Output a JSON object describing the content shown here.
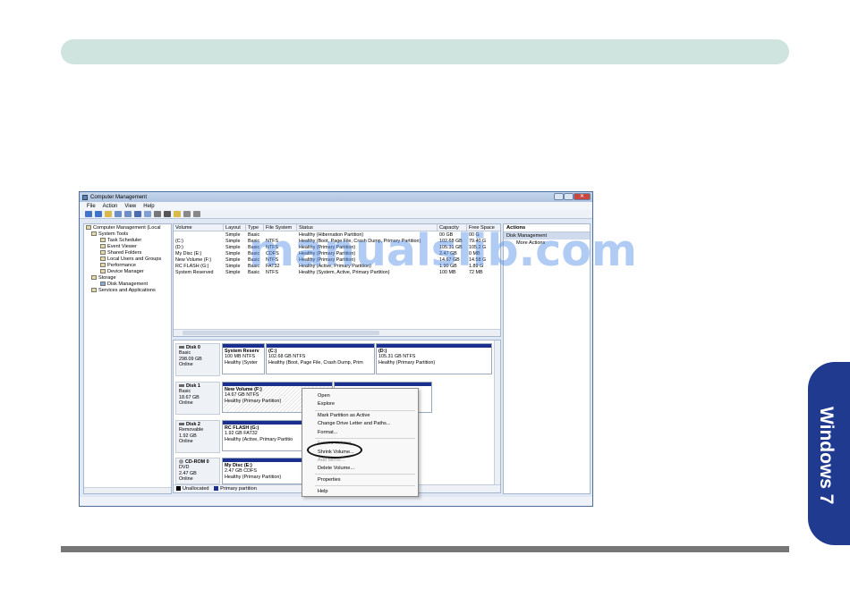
{
  "window": {
    "title": "Computer Management",
    "menu": [
      "File",
      "Action",
      "View",
      "Help"
    ]
  },
  "side_tab": {
    "label": "Windows 7"
  },
  "watermark": "manualslib.com",
  "tree": {
    "items": [
      "Computer Management (Local",
      "System Tools",
      "Task Scheduler",
      "Event Viewer",
      "Shared Folders",
      "Local Users and Groups",
      "Performance",
      "Device Manager",
      "Storage",
      "Disk Management",
      "Services and Applications"
    ]
  },
  "volumes": {
    "headers": [
      "Volume",
      "Layout",
      "Type",
      "File System",
      "Status",
      "Capacity",
      "Free Space"
    ],
    "rows": [
      [
        "",
        "Simple",
        "Basic",
        "",
        "Healthy (Hibernation Partition)",
        "00 GB",
        "00 G"
      ],
      [
        "(C:)",
        "Simple",
        "Basic",
        "NTFS",
        "Healthy (Boot, Page File, Crash Dump, Primary Partition)",
        "102.68 GB",
        "79.40 G"
      ],
      [
        "(D:)",
        "Simple",
        "Basic",
        "NTFS",
        "Healthy (Primary Partition)",
        "105.31 GB",
        "105.2 G"
      ],
      [
        "My Disc (E:)",
        "Simple",
        "Basic",
        "CDFS",
        "Healthy (Primary Partition)",
        "2.47 GB",
        "0 MB"
      ],
      [
        "New Volume (F:)",
        "Simple",
        "Basic",
        "NTFS",
        "Healthy (Primary Partition)",
        "14.67 GB",
        "14.58 G"
      ],
      [
        "RC FLASH (G:)",
        "Simple",
        "Basic",
        "FAT32",
        "Healthy (Active, Primary Partition)",
        "1.90 GB",
        "1.89 G"
      ],
      [
        "System Reserved",
        "Simple",
        "Basic",
        "NTFS",
        "Healthy (System, Active, Primary Partition)",
        "100 MB",
        "72 MB"
      ]
    ]
  },
  "disks": [
    {
      "name": "Disk 0",
      "type": "Basic",
      "size": "298.09 GB",
      "state": "Online",
      "partitions": [
        {
          "name": "System Reserv",
          "size": "100 MB NTFS",
          "status": "Healthy (Syster"
        },
        {
          "name": "(C:)",
          "size": "102.68 GB NTFS",
          "status": "Healthy (Boot, Page File, Crash Dump, Prim"
        },
        {
          "name": "(D:)",
          "size": "105.31 GB NTFS",
          "status": "Healthy (Primary Partition)"
        }
      ]
    },
    {
      "name": "Disk 1",
      "type": "Basic",
      "size": "18.67 GB",
      "state": "Online",
      "partitions": [
        {
          "name": "New Volume (F:)",
          "size": "14.67 GB NTFS",
          "status": "Healthy (Primary Partition)"
        }
      ]
    },
    {
      "name": "Disk 2",
      "type": "Removable",
      "size": "1.92 GB",
      "state": "Online",
      "partitions": [
        {
          "name": "RC FLASH (G:)",
          "size": "1.92 GB FAT32",
          "status": "Healthy (Active, Primary Partitio"
        }
      ]
    },
    {
      "name": "CD-ROM 0",
      "type": "DVD",
      "size": "2.47 GB",
      "state": "Online",
      "partitions": [
        {
          "name": "My Disc (E:)",
          "size": "2.47 GB CDFS",
          "status": "Healthy (Primary Partition)"
        }
      ]
    }
  ],
  "legend": {
    "unallocated": "Unallocated",
    "primary": "Primary partition"
  },
  "actions": {
    "title": "Actions",
    "section": "Disk Management",
    "item": "More Actions"
  },
  "context_menu": {
    "items": [
      {
        "label": "Open",
        "enabled": true
      },
      {
        "label": "Explore",
        "enabled": true
      },
      {
        "label": "Mark Partition as Active",
        "enabled": true
      },
      {
        "label": "Change Drive Letter and Paths...",
        "enabled": true
      },
      {
        "label": "Format...",
        "enabled": true
      },
      {
        "label": "Extend Volume...",
        "enabled": false
      },
      {
        "label": "Shrink Volume...",
        "enabled": true
      },
      {
        "label": "Add Mirror...",
        "enabled": false
      },
      {
        "label": "Delete Volume...",
        "enabled": true
      },
      {
        "label": "Properties",
        "enabled": true
      },
      {
        "label": "Help",
        "enabled": true
      }
    ]
  },
  "colors": {
    "primary_partition": "#1b2f8f",
    "unallocated": "#000000",
    "tab": "#1f3a8f",
    "top_bar": "#cfe3df"
  }
}
